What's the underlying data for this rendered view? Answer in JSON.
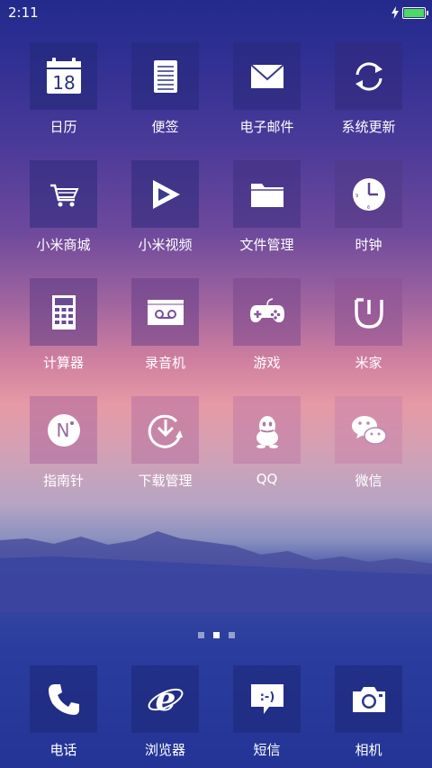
{
  "status": {
    "time": "2:11"
  },
  "apps": [
    {
      "label": "日历",
      "icon": "calendar-icon",
      "date": "18"
    },
    {
      "label": "便签",
      "icon": "notes-icon"
    },
    {
      "label": "电子邮件",
      "icon": "mail-icon"
    },
    {
      "label": "系统更新",
      "icon": "sync-icon"
    },
    {
      "label": "小米商城",
      "icon": "cart-icon"
    },
    {
      "label": "小米视频",
      "icon": "play-icon"
    },
    {
      "label": "文件管理",
      "icon": "folder-icon"
    },
    {
      "label": "时钟",
      "icon": "clock-icon"
    },
    {
      "label": "计算器",
      "icon": "calculator-icon"
    },
    {
      "label": "录音机",
      "icon": "recorder-icon"
    },
    {
      "label": "游戏",
      "icon": "gamepad-icon"
    },
    {
      "label": "米家",
      "icon": "mijia-icon"
    },
    {
      "label": "指南针",
      "icon": "compass-icon",
      "glyph": "N"
    },
    {
      "label": "下载管理",
      "icon": "download-icon"
    },
    {
      "label": "QQ",
      "icon": "qq-icon"
    },
    {
      "label": "微信",
      "icon": "wechat-icon"
    }
  ],
  "page_indicator": {
    "pages": 3,
    "current": 2
  },
  "dock": [
    {
      "label": "电话",
      "icon": "phone-icon"
    },
    {
      "label": "浏览器",
      "icon": "browser-icon",
      "glyph": "e"
    },
    {
      "label": "短信",
      "icon": "message-icon",
      "glyph": ":-)"
    },
    {
      "label": "相机",
      "icon": "camera-icon"
    }
  ]
}
